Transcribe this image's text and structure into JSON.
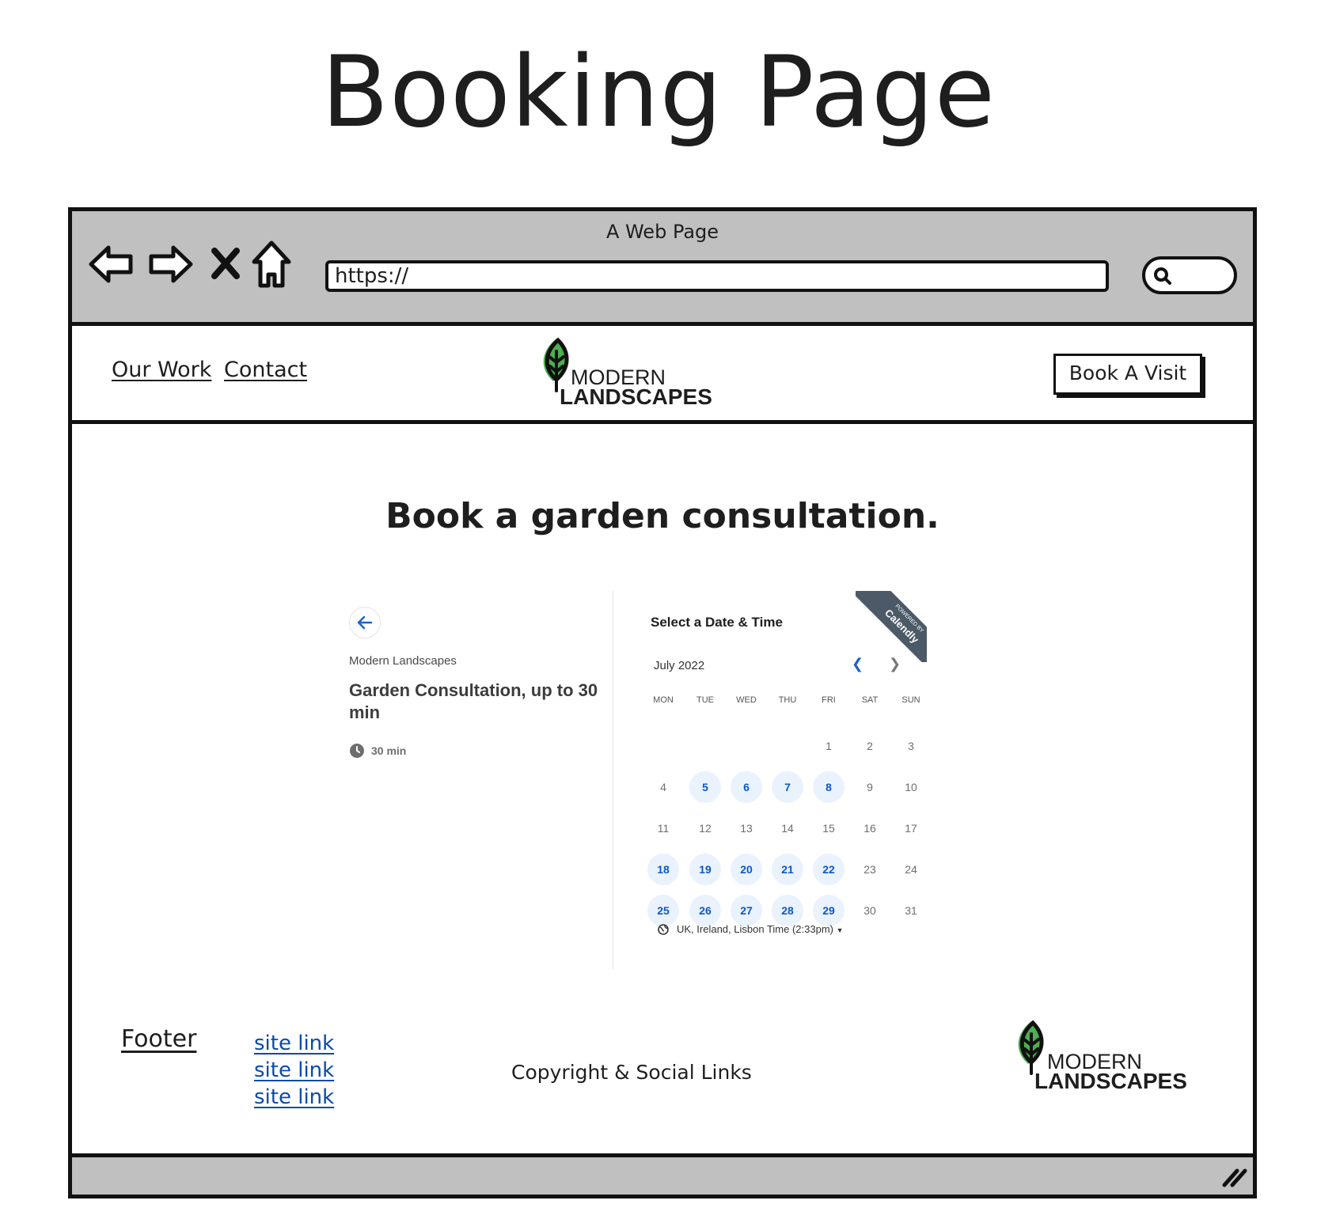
{
  "page_title": "Booking Page",
  "browser": {
    "window_title": "A Web Page",
    "url": "https://",
    "icons": [
      "back-arrow-icon",
      "forward-arrow-icon",
      "close-x-icon",
      "home-icon",
      "search-icon",
      "resize-grip-icon"
    ]
  },
  "header": {
    "nav": [
      {
        "label": "Our Work"
      },
      {
        "label": "Contact"
      }
    ],
    "logo": {
      "line1": "MODERN",
      "line2": "LANDSCAPES",
      "accent": "#4caf50"
    },
    "cta_label": "Book A Visit"
  },
  "main": {
    "heading": "Book a garden consultation."
  },
  "booking": {
    "organization": "Modern Landscapes",
    "event_name": "Garden Consultation, up to 30 min",
    "duration": "30 min",
    "select_title": "Select a Date & Time",
    "badge_small": "POWERED BY",
    "badge_big": "Calendly",
    "month": "July 2022",
    "weekdays": [
      "MON",
      "TUE",
      "WED",
      "THU",
      "FRI",
      "SAT",
      "SUN"
    ],
    "weeks": [
      [
        null,
        null,
        null,
        null,
        1,
        2,
        3
      ],
      [
        4,
        5,
        6,
        7,
        8,
        9,
        10
      ],
      [
        11,
        12,
        13,
        14,
        15,
        16,
        17
      ],
      [
        18,
        19,
        20,
        21,
        22,
        23,
        24
      ],
      [
        25,
        26,
        27,
        28,
        29,
        30,
        31
      ]
    ],
    "available_days": [
      5,
      6,
      7,
      8,
      18,
      19,
      20,
      21,
      22,
      25,
      26,
      27,
      28,
      29
    ],
    "timezone": "UK, Ireland, Lisbon Time (2:33pm)",
    "accent_color": "#0b58c9"
  },
  "footer": {
    "title": "Footer",
    "links": [
      {
        "label": "site link"
      },
      {
        "label": "site link"
      },
      {
        "label": "site link"
      }
    ],
    "center_text": "Copyright & Social Links"
  }
}
